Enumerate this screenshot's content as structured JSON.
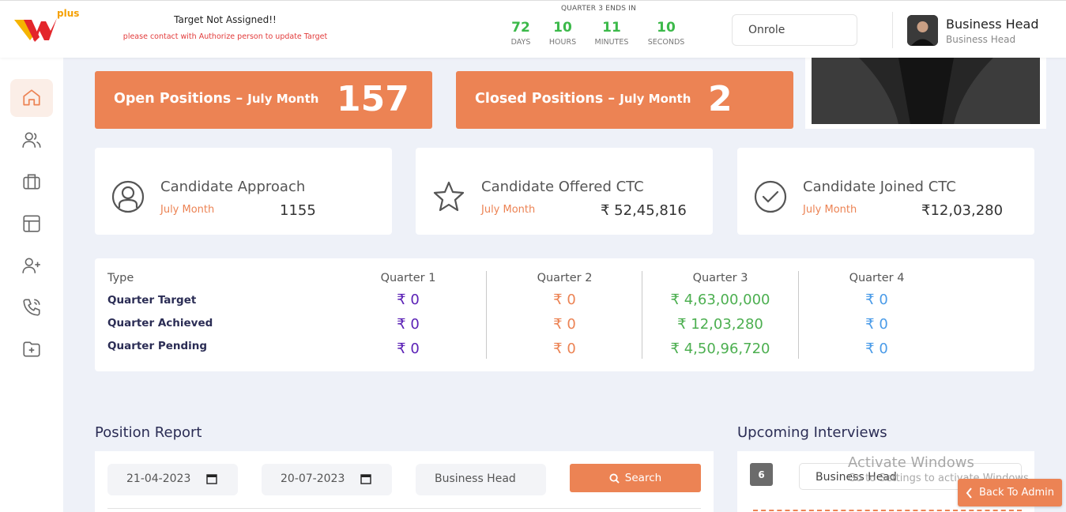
{
  "header": {
    "logo_text": "plus",
    "target_title": "Target Not Assigned!!",
    "target_sub": "please contact with Authorize person to update Target",
    "countdown_title": "QUARTER 3 ENDS IN",
    "countdown": [
      {
        "value": "72",
        "label": "DAYS"
      },
      {
        "value": "10",
        "label": "HOURS"
      },
      {
        "value": "11",
        "label": "MINUTES"
      },
      {
        "value": "10",
        "label": "SECONDS"
      }
    ],
    "role_select": "Onrole",
    "user_name": "Business Head",
    "user_role": "Business Head"
  },
  "sidebar": {
    "items": [
      {
        "name": "home-icon",
        "active": true
      },
      {
        "name": "users-icon",
        "active": false
      },
      {
        "name": "briefcase-icon",
        "active": false
      },
      {
        "name": "layout-icon",
        "active": false
      },
      {
        "name": "user-plus-icon",
        "active": false
      },
      {
        "name": "phone-icon",
        "active": false
      },
      {
        "name": "folder-plus-icon",
        "active": false
      }
    ]
  },
  "stats": {
    "open": {
      "label": "Open Positions",
      "sep": " – ",
      "month": "July Month",
      "value": "157"
    },
    "closed": {
      "label": "Closed Positions",
      "sep": " – ",
      "month": "July Month",
      "value": "2"
    }
  },
  "candidates": [
    {
      "icon": "user-circle-icon",
      "title": "Candidate Approach",
      "month": "July Month",
      "value": "1155"
    },
    {
      "icon": "star-icon",
      "title": "Candidate Offered CTC",
      "month": "July Month",
      "value": "₹ 52,45,816"
    },
    {
      "icon": "check-circle-icon",
      "title": "Candidate Joined CTC",
      "month": "July Month",
      "value": "₹12,03,280"
    }
  ],
  "quarters": {
    "type_label": "Type",
    "rows": [
      "Quarter Target",
      "Quarter Achieved",
      "Quarter Pending"
    ],
    "columns": [
      {
        "name": "Quarter 1",
        "color": "#5b21b6",
        "values": [
          "₹ 0",
          "₹ 0",
          "₹ 0"
        ]
      },
      {
        "name": "Quarter 2",
        "color": "#ec8354",
        "values": [
          "₹ 0",
          "₹ 0",
          "₹ 0"
        ]
      },
      {
        "name": "Quarter 3",
        "color": "#4caf50",
        "values": [
          "₹ 4,63,00,000",
          "₹ 12,03,280",
          "₹ 4,50,96,720"
        ]
      },
      {
        "name": "Quarter 4",
        "color": "#4a9be8",
        "values": [
          "₹ 0",
          "₹ 0",
          "₹ 0"
        ]
      }
    ]
  },
  "position_report": {
    "title": "Position Report",
    "from_date": "21-04-2023",
    "to_date": "20-07-2023",
    "role": "Business Head",
    "search_label": "Search"
  },
  "interviews": {
    "title": "Upcoming Interviews",
    "count": "6",
    "role": "Business Head"
  },
  "watermark": {
    "title": "Activate Windows",
    "sub": "Go to Settings to activate Windows."
  },
  "back_button": "Back To Admin",
  "colors": {
    "accent": "#ec8354",
    "green": "#3cb94a",
    "navy": "#2b2d55"
  }
}
